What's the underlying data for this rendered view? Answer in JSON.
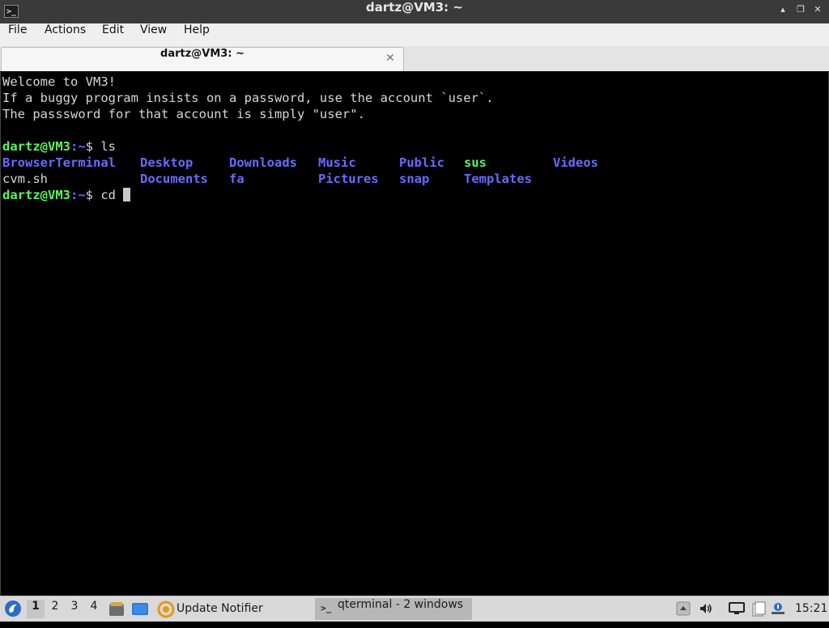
{
  "window": {
    "title": "dartz@VM3: ~",
    "controls": {
      "minimize": "▴",
      "restore": "❐",
      "close": "✕"
    }
  },
  "menubar": {
    "items": [
      "File",
      "Actions",
      "Edit",
      "View",
      "Help"
    ]
  },
  "tabs": [
    {
      "label": "dartz@VM3: ~",
      "close_glyph": "✕"
    }
  ],
  "terminal": {
    "welcome_lines": [
      "Welcome to VM3!",
      "If a buggy program insists on a password, use the account `user`.",
      "The passsword for that account is simply \"user\"."
    ],
    "prompt_user_host": "dartz@VM3",
    "prompt_path": ":~",
    "prompt_symbol": "$ ",
    "commands": [
      "ls",
      "cd "
    ],
    "ls_output": {
      "row1": [
        {
          "name": "BrowserTerminal",
          "kind": "dir"
        },
        {
          "name": "Desktop",
          "kind": "dir"
        },
        {
          "name": "Downloads",
          "kind": "dir"
        },
        {
          "name": "Music",
          "kind": "dir"
        },
        {
          "name": "Public",
          "kind": "dir"
        },
        {
          "name": "sus",
          "kind": "exe"
        },
        {
          "name": "Videos",
          "kind": "dir"
        }
      ],
      "row2": [
        {
          "name": "cvm.sh",
          "kind": "plain"
        },
        {
          "name": "Documents",
          "kind": "dir"
        },
        {
          "name": "fa",
          "kind": "dir"
        },
        {
          "name": "Pictures",
          "kind": "dir"
        },
        {
          "name": "snap",
          "kind": "dir"
        },
        {
          "name": "Templates",
          "kind": "dir"
        }
      ]
    },
    "colors": {
      "background": "#000000",
      "text": "#d6d6d6",
      "prompt_user": "#5ff35f",
      "directory": "#6a6aff",
      "executable": "#5ff35f"
    }
  },
  "taskbar": {
    "workspaces": [
      "1",
      "2",
      "3",
      "4"
    ],
    "active_workspace": "1",
    "update_notifier_label": "Update Notifier",
    "task_label": "qterminal - 2 windows",
    "clock": "15:21"
  }
}
